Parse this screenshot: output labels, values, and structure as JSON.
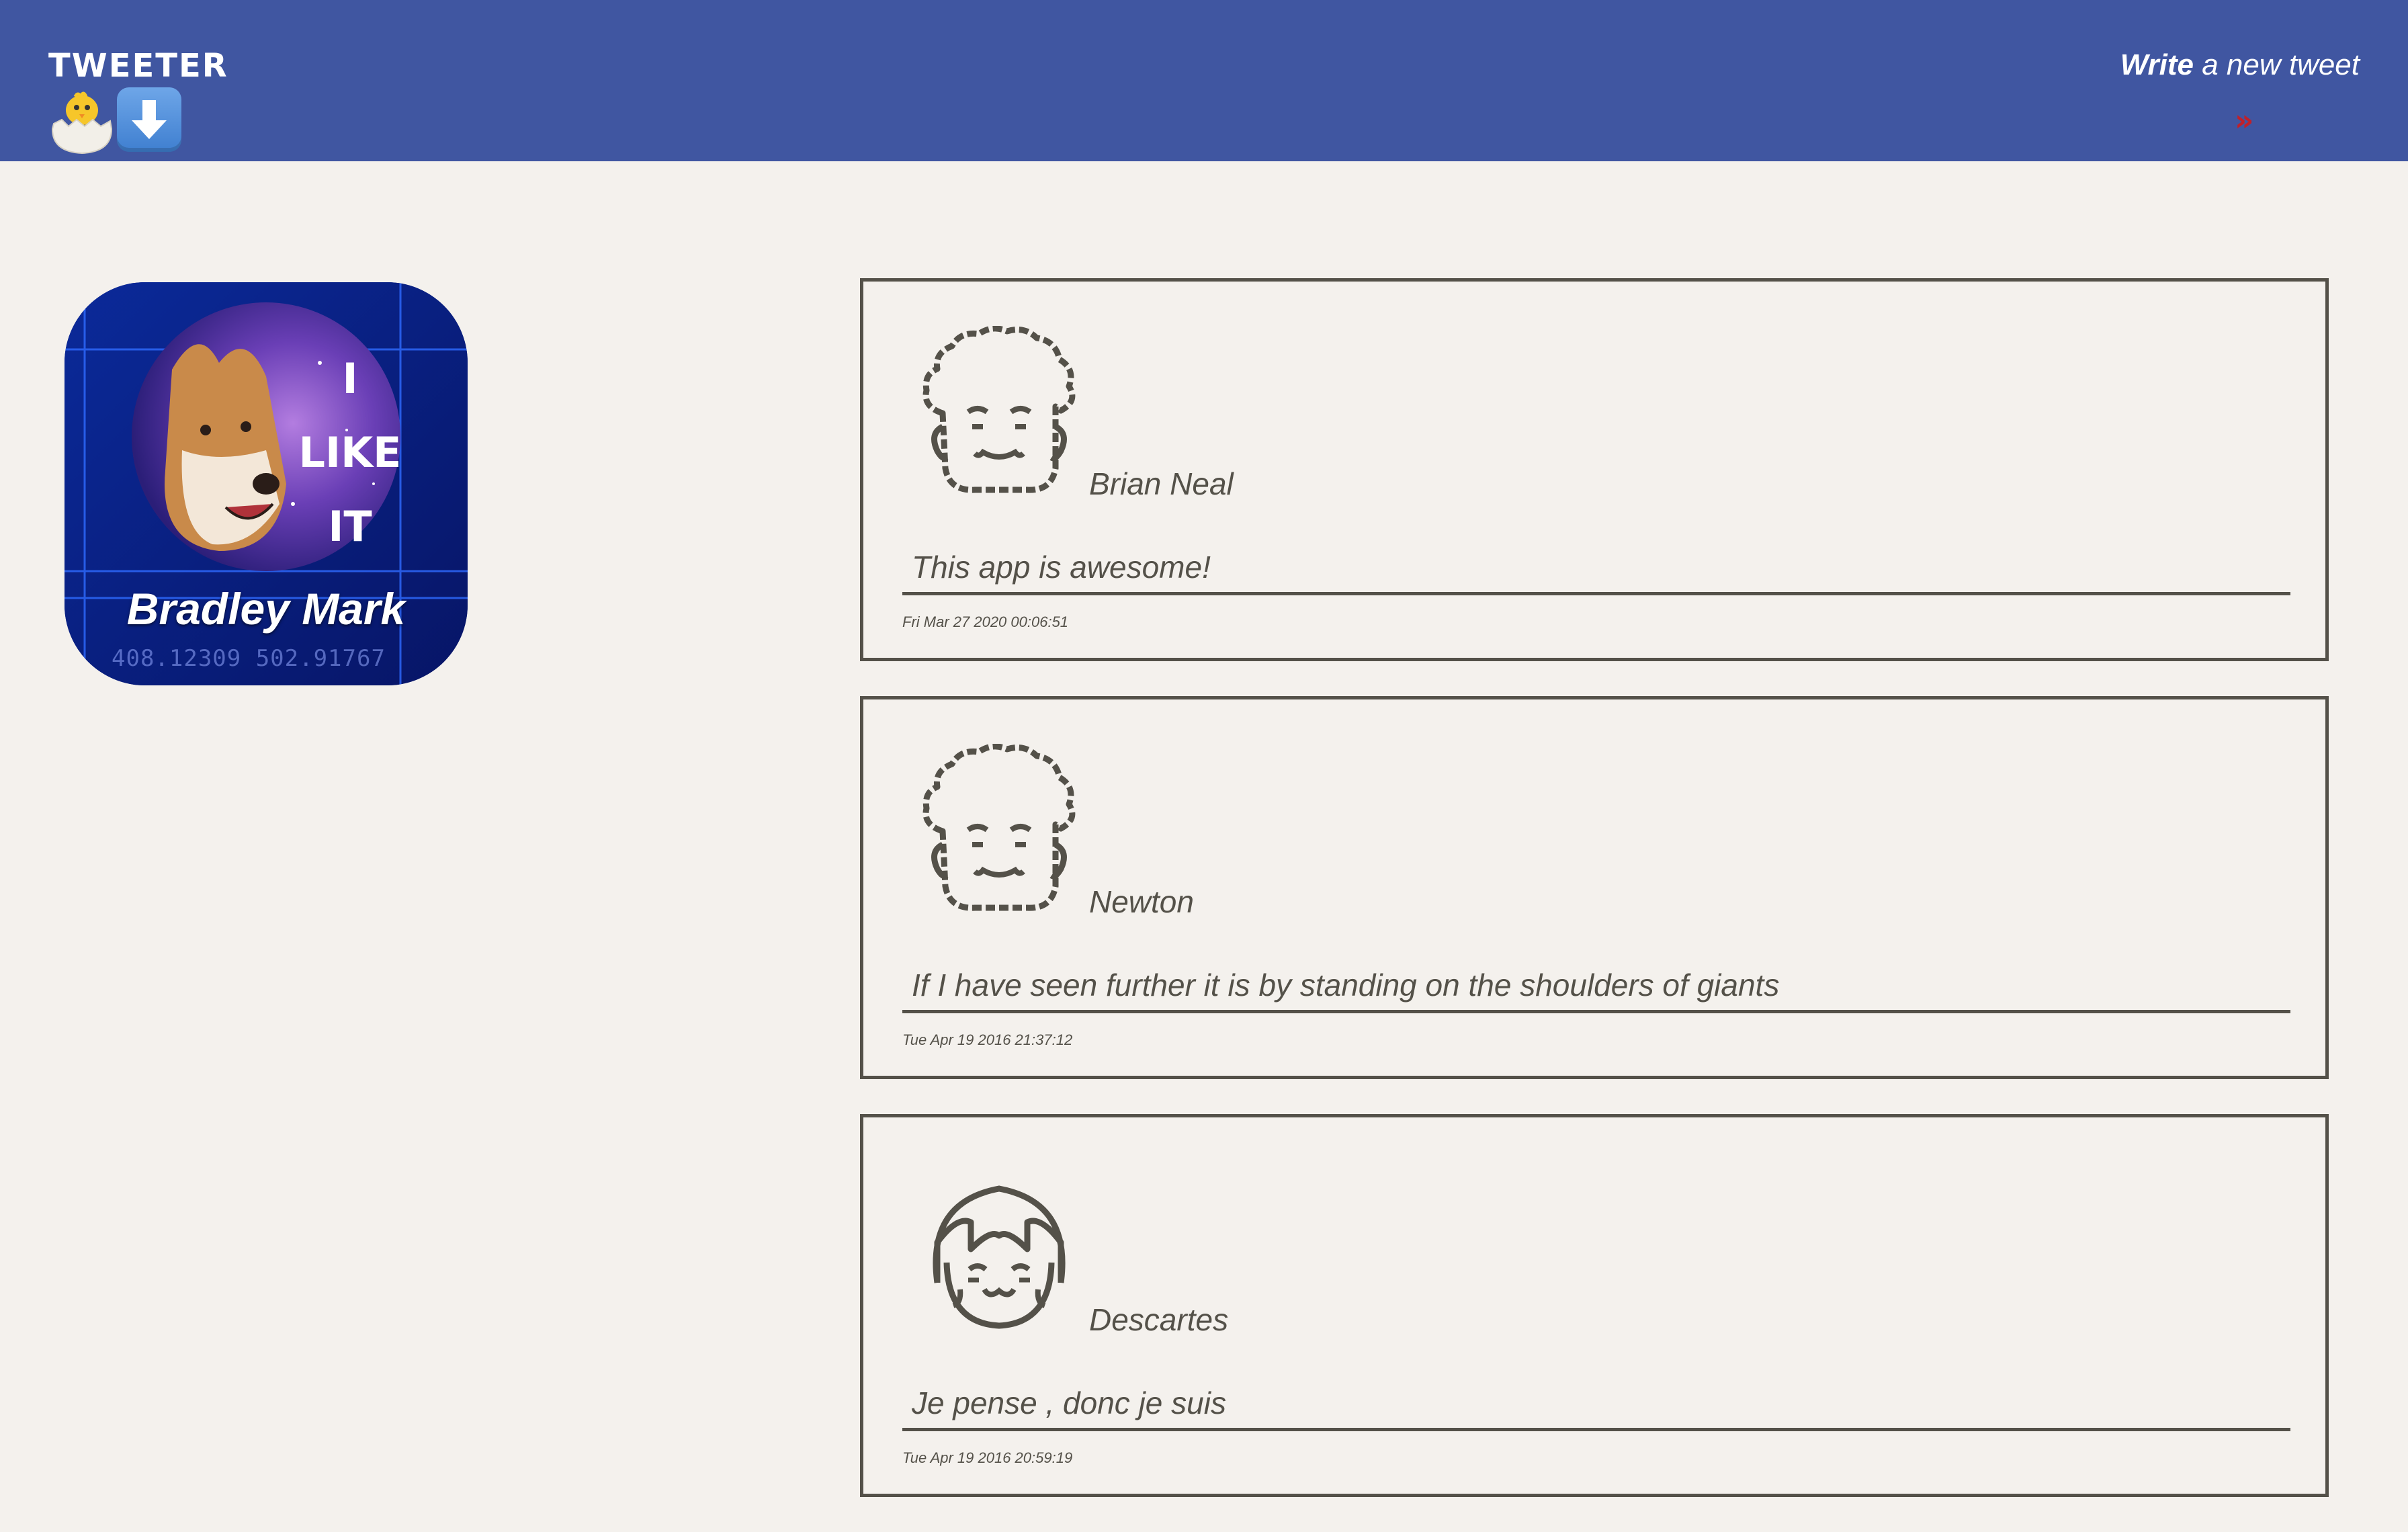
{
  "nav": {
    "brand": "TWEETER",
    "brand_icons": [
      "hatching-chick-icon",
      "down-arrow-icon"
    ],
    "compose_bold": "Write",
    "compose_rest": " a new tweet",
    "compose_toggle": "»",
    "color": "#4056a1",
    "toggle_color": "#c0202a"
  },
  "profile": {
    "name": "Bradley Mark",
    "image_text": [
      "I",
      "LIKE",
      "IT"
    ],
    "coords": "408.12309 502.91767"
  },
  "tweets": [
    {
      "author": "Brian Neal",
      "avatar": "man-curly-hair-avatar-icon",
      "text": "This app is awesome!",
      "date": "Fri Mar 27 2020 00:06:51"
    },
    {
      "author": "Newton",
      "avatar": "man-curly-hair-avatar-icon",
      "text": "If I have seen further it is by standing on the shoulders of giants",
      "date": "Tue Apr 19 2016 21:37:12"
    },
    {
      "author": "Descartes",
      "avatar": "woman-bangs-avatar-icon",
      "text": "Je pense , donc je suis",
      "date": "Tue Apr 19 2016 20:59:19"
    }
  ],
  "colors": {
    "page_bg": "#f4f1ed",
    "ink": "#545149"
  }
}
